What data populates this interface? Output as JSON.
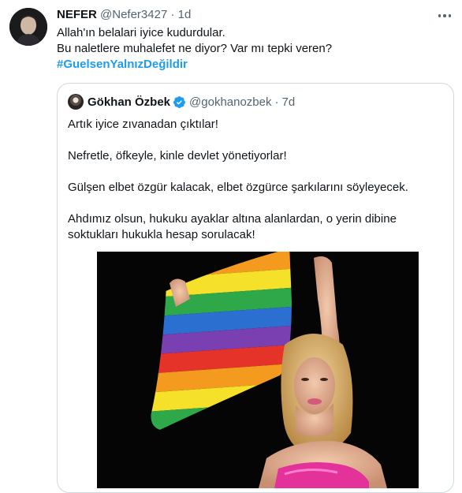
{
  "tweet": {
    "author_name": "NEFER",
    "author_handle": "@Nefer3427",
    "separator": "·",
    "time": "1d",
    "lines": [
      "Allah'ın belalari iyice kudurdular.",
      "Bu naletlere muhalefet ne diyor? Var mı tepki veren?"
    ],
    "hashtag": "#GuelsenYalnızDeğildir"
  },
  "quote": {
    "author_name": "Gökhan Özbek",
    "author_handle": "@gokhanozbek",
    "separator": "·",
    "time": "7d",
    "paragraphs": [
      "Artık iyice zıvanadan çıktılar!",
      "Nefretle, öfkeyle, kinle devlet yönetiyorlar!",
      "Gülşen elbet özgür kalacak, elbet özgürce şarkılarını söyleyecek.",
      "Ahdımız olsun, hukuku ayaklar altına alanlardan, o yerin dibine",
      "soktukları hukukla hesap sorulacak!"
    ]
  },
  "colors": {
    "text": "#0f1419",
    "muted": "#536471",
    "link": "#1d9bf0",
    "border": "#cfd9de"
  },
  "icons": [
    "more-icon",
    "verified-badge-icon"
  ]
}
